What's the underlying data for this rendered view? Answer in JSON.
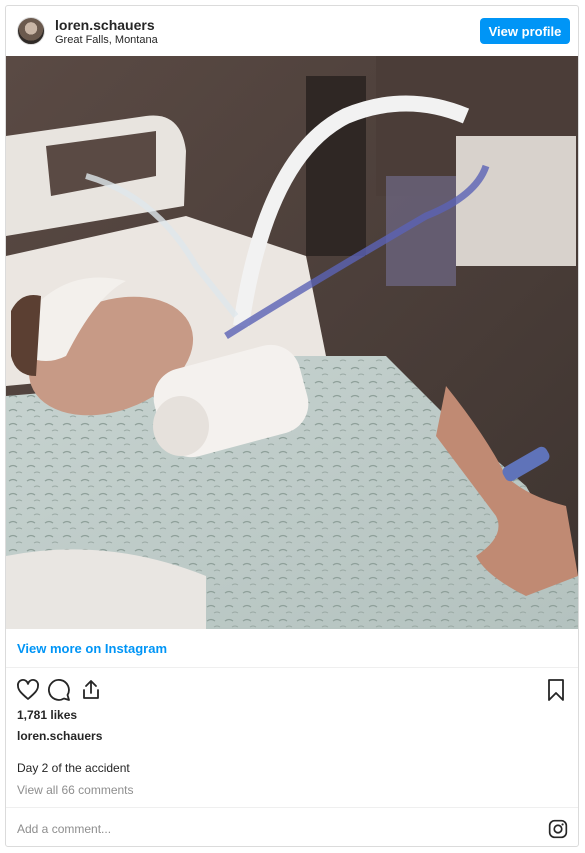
{
  "header": {
    "username": "loren.schauers",
    "location": "Great Falls, Montana",
    "view_profile_label": "View profile"
  },
  "post": {
    "view_more_label": "View more on Instagram",
    "likes": "1,781 likes",
    "owner": "loren.schauers",
    "caption": "Day 2 of the accident",
    "view_all_comments": "View all 66 comments"
  },
  "footer": {
    "add_comment_placeholder": "Add a comment..."
  },
  "icons": {
    "like": "heart-icon",
    "comment": "comment-icon",
    "share": "share-icon",
    "save": "bookmark-icon",
    "brand": "instagram-icon"
  },
  "colors": {
    "accent": "#0095f6",
    "text": "#262626",
    "muted": "#8e8e8e",
    "border": "#dbdbdb"
  }
}
